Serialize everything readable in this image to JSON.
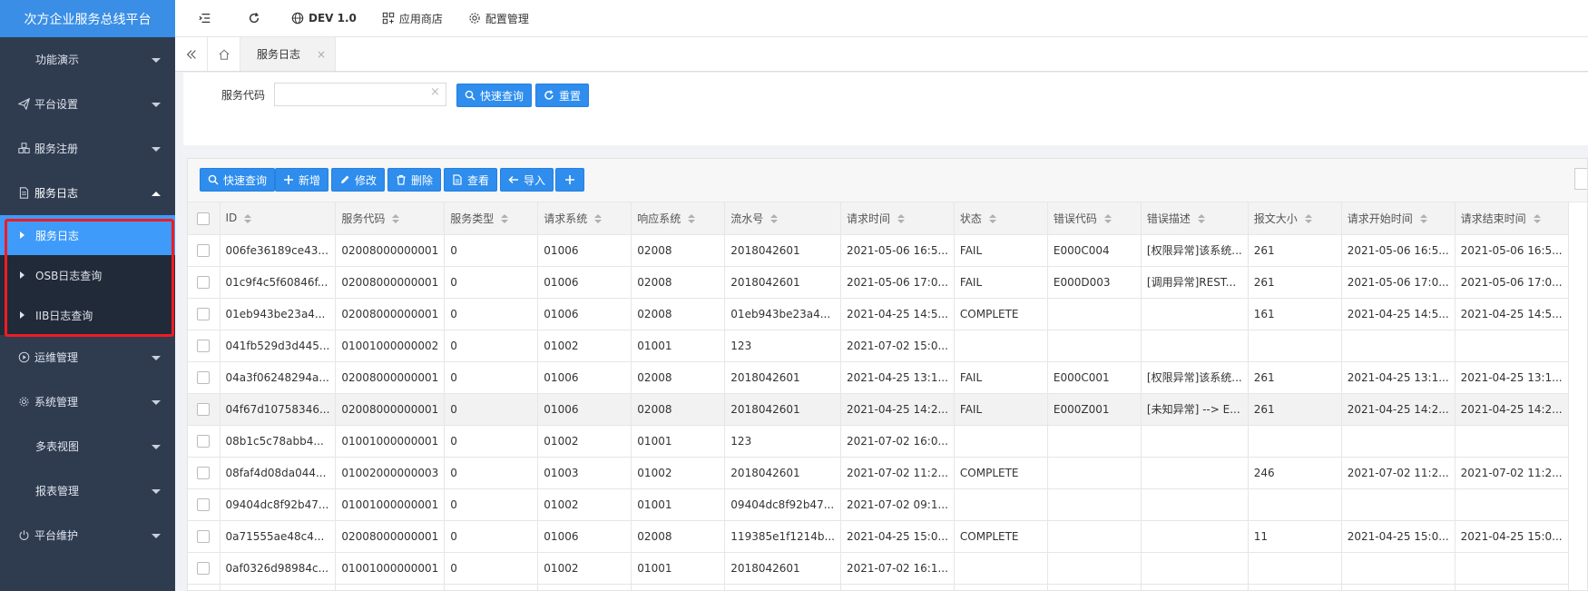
{
  "app": {
    "title": "次方企业服务总线平台"
  },
  "topbar": {
    "env_label": "DEV 1.0",
    "app_store_label": "应用商店",
    "config_label": "配置管理"
  },
  "sidebar": {
    "items": [
      {
        "label": "功能演示",
        "icon": "none"
      },
      {
        "label": "平台设置",
        "icon": "paper-plane-icon"
      },
      {
        "label": "服务注册",
        "icon": "cubes-icon"
      },
      {
        "label": "服务日志",
        "icon": "document-icon",
        "expanded": true
      }
    ],
    "sub_items": [
      {
        "label": "服务日志",
        "active": true
      },
      {
        "label": "OSB日志查询"
      },
      {
        "label": "IIB日志查询"
      }
    ],
    "items_after": [
      {
        "label": "运维管理",
        "icon": "play-circle-icon"
      },
      {
        "label": "系统管理",
        "icon": "gear-icon"
      },
      {
        "label": "多表视图",
        "icon": "none"
      },
      {
        "label": "报表管理",
        "icon": "none"
      },
      {
        "label": "平台维护",
        "icon": "power-icon"
      }
    ]
  },
  "tabs": [
    {
      "label": "服务日志"
    }
  ],
  "search": {
    "label": "服务代码",
    "value": "",
    "clear_icon": "×",
    "query_button": "快速查询",
    "reset_button": "重置"
  },
  "toolbar": {
    "query": "快速查询",
    "add": "新增",
    "edit": "修改",
    "delete": "删除",
    "view": "查看",
    "import": "导入"
  },
  "table": {
    "columns": [
      "ID",
      "服务代码",
      "服务类型",
      "请求系统",
      "响应系统",
      "流水号",
      "请求时间",
      "状态",
      "错误代码",
      "错误描述",
      "报文大小",
      "请求开始时间",
      "请求结束时间"
    ],
    "rows": [
      [
        "006fe36189ce43...",
        "02008000000001",
        "0",
        "01006",
        "02008",
        "2018042601",
        "2021-05-06 16:5...",
        "FAIL",
        "E000C004",
        "[权限异常]该系统...",
        "261",
        "2021-05-06 16:5...",
        "2021-05-06 16:5..."
      ],
      [
        "01c9f4c5f60846f...",
        "02008000000001",
        "0",
        "01006",
        "02008",
        "2018042601",
        "2021-05-06 17:0...",
        "FAIL",
        "E000D003",
        "[调用异常]REST...",
        "261",
        "2021-05-06 17:0...",
        "2021-05-06 17:0..."
      ],
      [
        "01eb943be23a4...",
        "02008000000001",
        "0",
        "01006",
        "02008",
        "01eb943be23a4...",
        "2021-04-25 14:5...",
        "COMPLETE",
        "",
        "",
        "161",
        "2021-04-25 14:5...",
        "2021-04-25 14:5..."
      ],
      [
        "041fb529d3d445...",
        "01001000000002",
        "0",
        "01002",
        "01001",
        "123",
        "2021-07-02 15:0...",
        "",
        "",
        "",
        "",
        "",
        ""
      ],
      [
        "04a3f06248294a...",
        "02008000000001",
        "0",
        "01006",
        "02008",
        "2018042601",
        "2021-04-25 13:1...",
        "FAIL",
        "E000C001",
        "[权限异常]该系统...",
        "261",
        "2021-04-25 13:1...",
        "2021-04-25 13:1..."
      ],
      [
        "04f67d10758346...",
        "02008000000001",
        "0",
        "01006",
        "02008",
        "2018042601",
        "2021-04-25 14:2...",
        "FAIL",
        "E000Z001",
        "[未知异常] --> E...",
        "261",
        "2021-04-25 14:2...",
        "2021-04-25 14:2..."
      ],
      [
        "08b1c5c78abb4...",
        "01001000000001",
        "0",
        "01002",
        "01001",
        "123",
        "2021-07-02 16:0...",
        "",
        "",
        "",
        "",
        "",
        ""
      ],
      [
        "08faf4d08da044...",
        "01002000000003",
        "0",
        "01003",
        "01002",
        "2018042601",
        "2021-07-02 11:2...",
        "COMPLETE",
        "",
        "",
        "246",
        "2021-07-02 11:2...",
        "2021-07-02 11:2..."
      ],
      [
        "09404dc8f92b47...",
        "01001000000001",
        "0",
        "01002",
        "01001",
        "09404dc8f92b47...",
        "2021-07-02 09:1...",
        "",
        "",
        "",
        "",
        "",
        ""
      ],
      [
        "0a71555ae48c4...",
        "02008000000001",
        "0",
        "01006",
        "02008",
        "119385e1f1214b...",
        "2021-04-25 15:0...",
        "COMPLETE",
        "",
        "",
        "11",
        "2021-04-25 15:0...",
        "2021-04-25 15:0..."
      ],
      [
        "0af0326d98984c...",
        "01001000000001",
        "0",
        "01002",
        "01001",
        "2018042601",
        "2021-07-02 16:1...",
        "",
        "",
        "",
        "",
        "",
        ""
      ]
    ]
  },
  "colors": {
    "sidebar_bg": "#2f3c50",
    "logo_bg": "#3a8ee6",
    "active_item": "#3e9bfa",
    "button_blue": "#2e8ded",
    "highlight_red": "#ee1c24"
  }
}
